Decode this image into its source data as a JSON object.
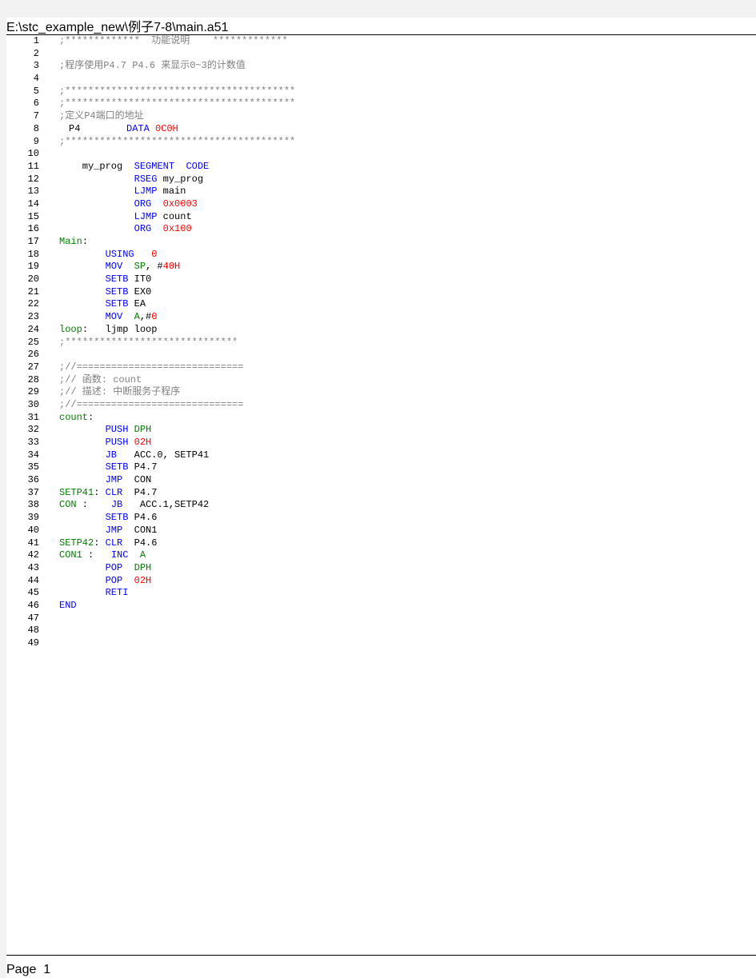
{
  "document": {
    "file_path": "E:\\stc_example_new\\例子7-8\\main.a51",
    "footer": "Page  1"
  },
  "colors": {
    "comment": "#808080",
    "keyword": "#0000ff",
    "number": "#ff0000",
    "label": "#008000",
    "plain": "#000000"
  },
  "lines": [
    {
      "n": "1",
      "tokens": [
        [
          "c",
          ";*************  功能说明    *************"
        ]
      ]
    },
    {
      "n": "2",
      "tokens": []
    },
    {
      "n": "3",
      "tokens": [
        [
          "c",
          ";程序使用P4.7 P4.6 来显示0~3的计数值"
        ]
      ]
    },
    {
      "n": "4",
      "tokens": []
    },
    {
      "n": "5",
      "tokens": [
        [
          "c",
          ";****************************************"
        ]
      ]
    },
    {
      "n": "6",
      "tokens": [
        [
          "c",
          ";****************************************"
        ]
      ]
    },
    {
      "n": "7",
      "tokens": [
        [
          "c",
          ";定义P4端口的地址"
        ]
      ]
    },
    {
      "n": "8",
      "tokens": [
        [
          "p",
          "P4"
        ],
        [
          "p",
          "        "
        ],
        [
          "k",
          "DATA"
        ],
        [
          "p",
          " "
        ],
        [
          "n",
          "0C0H"
        ]
      ],
      "indent": -1
    },
    {
      "n": "9",
      "tokens": [
        [
          "c",
          ";****************************************"
        ]
      ]
    },
    {
      "n": "10",
      "tokens": []
    },
    {
      "n": "11",
      "tokens": [
        [
          "p",
          "    my_prog  "
        ],
        [
          "k",
          "SEGMENT"
        ],
        [
          "p",
          "  "
        ],
        [
          "k",
          "CODE"
        ]
      ]
    },
    {
      "n": "12",
      "tokens": [
        [
          "p",
          "             "
        ],
        [
          "k",
          "RSEG"
        ],
        [
          "p",
          " my_prog"
        ]
      ]
    },
    {
      "n": "13",
      "tokens": [
        [
          "p",
          "             "
        ],
        [
          "k",
          "LJMP"
        ],
        [
          "p",
          " main"
        ]
      ]
    },
    {
      "n": "14",
      "tokens": [
        [
          "p",
          "             "
        ],
        [
          "k",
          "ORG"
        ],
        [
          "p",
          "  "
        ],
        [
          "n",
          "0x0003"
        ]
      ]
    },
    {
      "n": "15",
      "tokens": [
        [
          "p",
          "             "
        ],
        [
          "k",
          "LJMP"
        ],
        [
          "p",
          " count"
        ]
      ]
    },
    {
      "n": "16",
      "tokens": [
        [
          "p",
          "             "
        ],
        [
          "k",
          "ORG"
        ],
        [
          "p",
          "  "
        ],
        [
          "n",
          "0x100"
        ]
      ]
    },
    {
      "n": "17",
      "tokens": [
        [
          "l",
          "Main"
        ],
        [
          "p",
          ":"
        ]
      ]
    },
    {
      "n": "18",
      "tokens": [
        [
          "p",
          "        "
        ],
        [
          "k",
          "USING"
        ],
        [
          "p",
          "   "
        ],
        [
          "n",
          "0"
        ]
      ]
    },
    {
      "n": "19",
      "tokens": [
        [
          "p",
          "        "
        ],
        [
          "k",
          "MOV"
        ],
        [
          "p",
          "  "
        ],
        [
          "l",
          "SP"
        ],
        [
          "p",
          ", #"
        ],
        [
          "n",
          "40H"
        ]
      ]
    },
    {
      "n": "20",
      "tokens": [
        [
          "p",
          "        "
        ],
        [
          "k",
          "SETB"
        ],
        [
          "p",
          " IT0"
        ]
      ]
    },
    {
      "n": "21",
      "tokens": [
        [
          "p",
          "        "
        ],
        [
          "k",
          "SETB"
        ],
        [
          "p",
          " EX0"
        ]
      ]
    },
    {
      "n": "22",
      "tokens": [
        [
          "p",
          "        "
        ],
        [
          "k",
          "SETB"
        ],
        [
          "p",
          " EA"
        ]
      ]
    },
    {
      "n": "23",
      "tokens": [
        [
          "p",
          "        "
        ],
        [
          "k",
          "MOV"
        ],
        [
          "p",
          "  "
        ],
        [
          "l",
          "A"
        ],
        [
          "p",
          ",#"
        ],
        [
          "n",
          "0"
        ]
      ]
    },
    {
      "n": "24",
      "tokens": [
        [
          "l",
          "loop"
        ],
        [
          "p",
          ":   ljmp loop"
        ]
      ]
    },
    {
      "n": "25",
      "tokens": [
        [
          "c",
          ";******************************"
        ]
      ]
    },
    {
      "n": "26",
      "tokens": []
    },
    {
      "n": "27",
      "tokens": [
        [
          "c",
          ";//============================="
        ]
      ]
    },
    {
      "n": "28",
      "tokens": [
        [
          "c",
          ";// 函数: count"
        ]
      ]
    },
    {
      "n": "29",
      "tokens": [
        [
          "c",
          ";// 描述: 中断服务子程序"
        ]
      ]
    },
    {
      "n": "30",
      "tokens": [
        [
          "c",
          ";//============================="
        ]
      ]
    },
    {
      "n": "31",
      "tokens": [
        [
          "l",
          "count"
        ],
        [
          "p",
          ":"
        ]
      ]
    },
    {
      "n": "32",
      "tokens": [
        [
          "p",
          "        "
        ],
        [
          "k",
          "PUSH"
        ],
        [
          "p",
          " "
        ],
        [
          "l",
          "DPH"
        ]
      ]
    },
    {
      "n": "33",
      "tokens": [
        [
          "p",
          "        "
        ],
        [
          "k",
          "PUSH"
        ],
        [
          "p",
          " "
        ],
        [
          "n",
          "02H"
        ]
      ]
    },
    {
      "n": "34",
      "tokens": [
        [
          "p",
          "        "
        ],
        [
          "k",
          "JB"
        ],
        [
          "p",
          "   ACC.0, SETP41"
        ]
      ]
    },
    {
      "n": "35",
      "tokens": [
        [
          "p",
          "        "
        ],
        [
          "k",
          "SETB"
        ],
        [
          "p",
          " P4.7"
        ]
      ]
    },
    {
      "n": "36",
      "tokens": [
        [
          "p",
          "        "
        ],
        [
          "k",
          "JMP"
        ],
        [
          "p",
          "  CON"
        ]
      ]
    },
    {
      "n": "37",
      "tokens": [
        [
          "l",
          "SETP41"
        ],
        [
          "p",
          ": "
        ],
        [
          "k",
          "CLR"
        ],
        [
          "p",
          "  P4.7"
        ]
      ]
    },
    {
      "n": "38",
      "tokens": [
        [
          "l",
          "CON"
        ],
        [
          "p",
          " :    "
        ],
        [
          "k",
          "JB"
        ],
        [
          "p",
          "   ACC.1,SETP42"
        ]
      ]
    },
    {
      "n": "39",
      "tokens": [
        [
          "p",
          "        "
        ],
        [
          "k",
          "SETB"
        ],
        [
          "p",
          " P4.6"
        ]
      ]
    },
    {
      "n": "40",
      "tokens": [
        [
          "p",
          "        "
        ],
        [
          "k",
          "JMP"
        ],
        [
          "p",
          "  CON1"
        ]
      ]
    },
    {
      "n": "41",
      "tokens": [
        [
          "l",
          "SETP42"
        ],
        [
          "p",
          ": "
        ],
        [
          "k",
          "CLR"
        ],
        [
          "p",
          "  P4.6"
        ]
      ]
    },
    {
      "n": "42",
      "tokens": [
        [
          "l",
          "CON1"
        ],
        [
          "p",
          " :   "
        ],
        [
          "k",
          "INC"
        ],
        [
          "p",
          "  "
        ],
        [
          "l",
          "A"
        ]
      ]
    },
    {
      "n": "43",
      "tokens": [
        [
          "p",
          "        "
        ],
        [
          "k",
          "POP"
        ],
        [
          "p",
          "  "
        ],
        [
          "l",
          "DPH"
        ]
      ]
    },
    {
      "n": "44",
      "tokens": [
        [
          "p",
          "        "
        ],
        [
          "k",
          "POP"
        ],
        [
          "p",
          "  "
        ],
        [
          "n",
          "02H"
        ]
      ]
    },
    {
      "n": "45",
      "tokens": [
        [
          "p",
          "        "
        ],
        [
          "k",
          "RETI"
        ]
      ]
    },
    {
      "n": "46",
      "tokens": [
        [
          "k",
          "END"
        ]
      ]
    },
    {
      "n": "47",
      "tokens": []
    },
    {
      "n": "48",
      "tokens": []
    },
    {
      "n": "49",
      "tokens": []
    }
  ]
}
